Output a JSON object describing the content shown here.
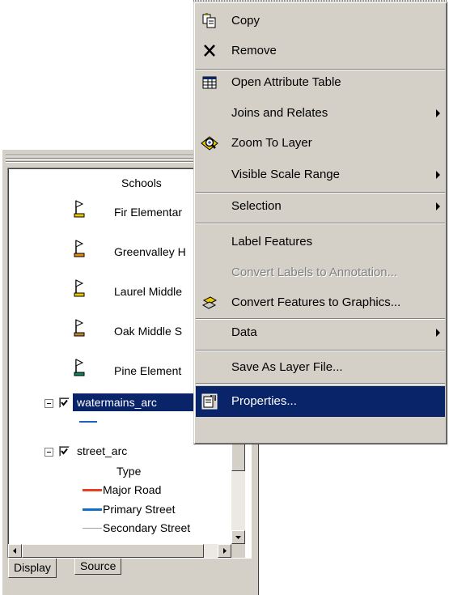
{
  "toc": {
    "layer_group_label": "Schools",
    "schools": [
      {
        "label": "Fir Elementar",
        "flag_color": "#e8c800"
      },
      {
        "label": "Greenvalley H",
        "flag_color": "#e08a10"
      },
      {
        "label": "Laurel Middle",
        "flag_color": "#e8c800"
      },
      {
        "label": "Oak Middle S",
        "flag_color": "#c08030"
      },
      {
        "label": "Pine Element",
        "flag_color": "#108060"
      }
    ],
    "layers": [
      {
        "name": "watermains_arc",
        "checked": true,
        "selected": true,
        "symbol_color": "#2060c0"
      },
      {
        "name": "street_arc",
        "checked": true,
        "selected": false
      }
    ],
    "street_legend": {
      "heading": "Type",
      "items": [
        {
          "label": "Major Road",
          "color": "#e84020"
        },
        {
          "label": "Primary Street",
          "color": "#1070c8"
        },
        {
          "label": "Secondary Street",
          "color": "#a0a0a0"
        }
      ]
    },
    "tabs": [
      "Display",
      "Source"
    ],
    "active_tab": "Display"
  },
  "context_menu": {
    "items": [
      {
        "label": "Copy",
        "icon": "copy-icon"
      },
      {
        "label": "Remove",
        "icon": "remove-icon"
      },
      {
        "label": "Open Attribute Table",
        "icon": "attribute-table-icon"
      },
      {
        "label": "Joins and Relates",
        "submenu": true
      },
      {
        "label": "Zoom To Layer",
        "icon": "zoom-to-layer-icon"
      },
      {
        "label": "Visible Scale Range",
        "submenu": true
      },
      {
        "label": "Selection",
        "submenu": true
      },
      {
        "label": "Label Features"
      },
      {
        "label": "Convert Labels to Annotation...",
        "disabled": true
      },
      {
        "label": "Convert Features to Graphics...",
        "icon": "convert-graphics-icon"
      },
      {
        "label": "Data",
        "submenu": true
      },
      {
        "label": "Save As Layer File..."
      },
      {
        "label": "Properties...",
        "icon": "properties-icon",
        "highlighted": true
      }
    ]
  }
}
